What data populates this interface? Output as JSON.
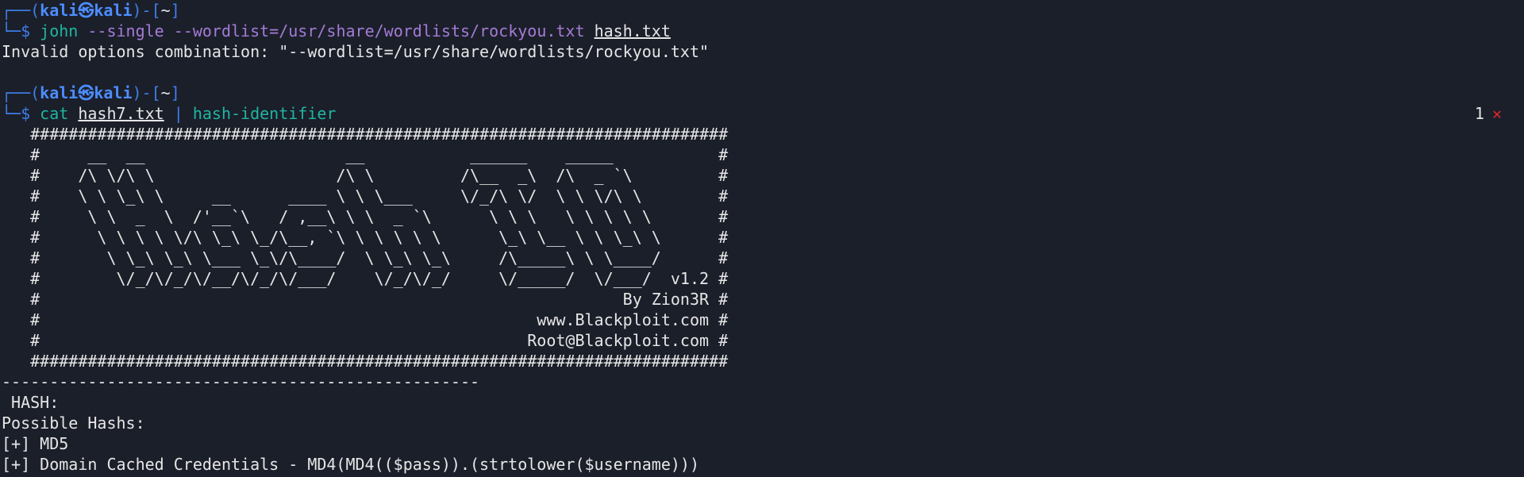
{
  "prompt1": {
    "top_left": "┌──(",
    "user": "kali",
    "at": "㉿",
    "host": "kali",
    "mid": ")-[",
    "path": "~",
    "end": "]",
    "bottom": "└─$ ",
    "cmd": "john",
    "args": " --single --wordlist=/usr/share/wordlists/rockyou.txt ",
    "file": "hash.txt"
  },
  "error_line": "Invalid options combination: \"--wordlist=/usr/share/wordlists/rockyou.txt\"",
  "prompt2": {
    "top_left": "┌──(",
    "user": "kali",
    "at": "㉿",
    "host": "kali",
    "mid": ")-[",
    "path": "~",
    "end": "]",
    "bottom": "└─$ ",
    "cmd": "cat",
    "file": "hash7.txt",
    "pipe": " | ",
    "cmd2": "hash-identifier"
  },
  "status": {
    "exit_code": "1",
    "error_mark": "✕"
  },
  "banner": [
    "   #########################################################################",
    "   #     __  __                     __           ______    _____           #",
    "   #    /\\ \\/\\ \\                   /\\ \\         /\\__  _\\  /\\  _ `\\         #",
    "   #    \\ \\ \\_\\ \\     __      ____ \\ \\ \\___     \\/_/\\ \\/  \\ \\ \\/\\ \\        #",
    "   #     \\ \\  _  \\  /'__`\\   / ,__\\ \\ \\  _ `\\      \\ \\ \\   \\ \\ \\ \\ \\       #",
    "   #      \\ \\ \\ \\ \\/\\ \\_\\ \\_/\\__, `\\ \\ \\ \\ \\ \\      \\_\\ \\__ \\ \\ \\_\\ \\      #",
    "   #       \\ \\_\\ \\_\\ \\___ \\_\\/\\____/  \\ \\_\\ \\_\\     /\\_____\\ \\ \\____/      #",
    "   #        \\/_/\\/_/\\/__/\\/_/\\/___/    \\/_/\\/_/     \\/_____/  \\/___/  v1.2 #",
    "   #                                                             By Zion3R #",
    "   #                                                    www.Blackploit.com #",
    "   #                                                   Root@Blackploit.com #",
    "   #########################################################################"
  ],
  "separator": "--------------------------------------------------",
  "hash_label": " HASH: ",
  "possible_label": "Possible Hashs:",
  "results": [
    "[+] MD5",
    "[+] Domain Cached Credentials - MD4(MD4(($pass)).(strtolower($username)))"
  ]
}
